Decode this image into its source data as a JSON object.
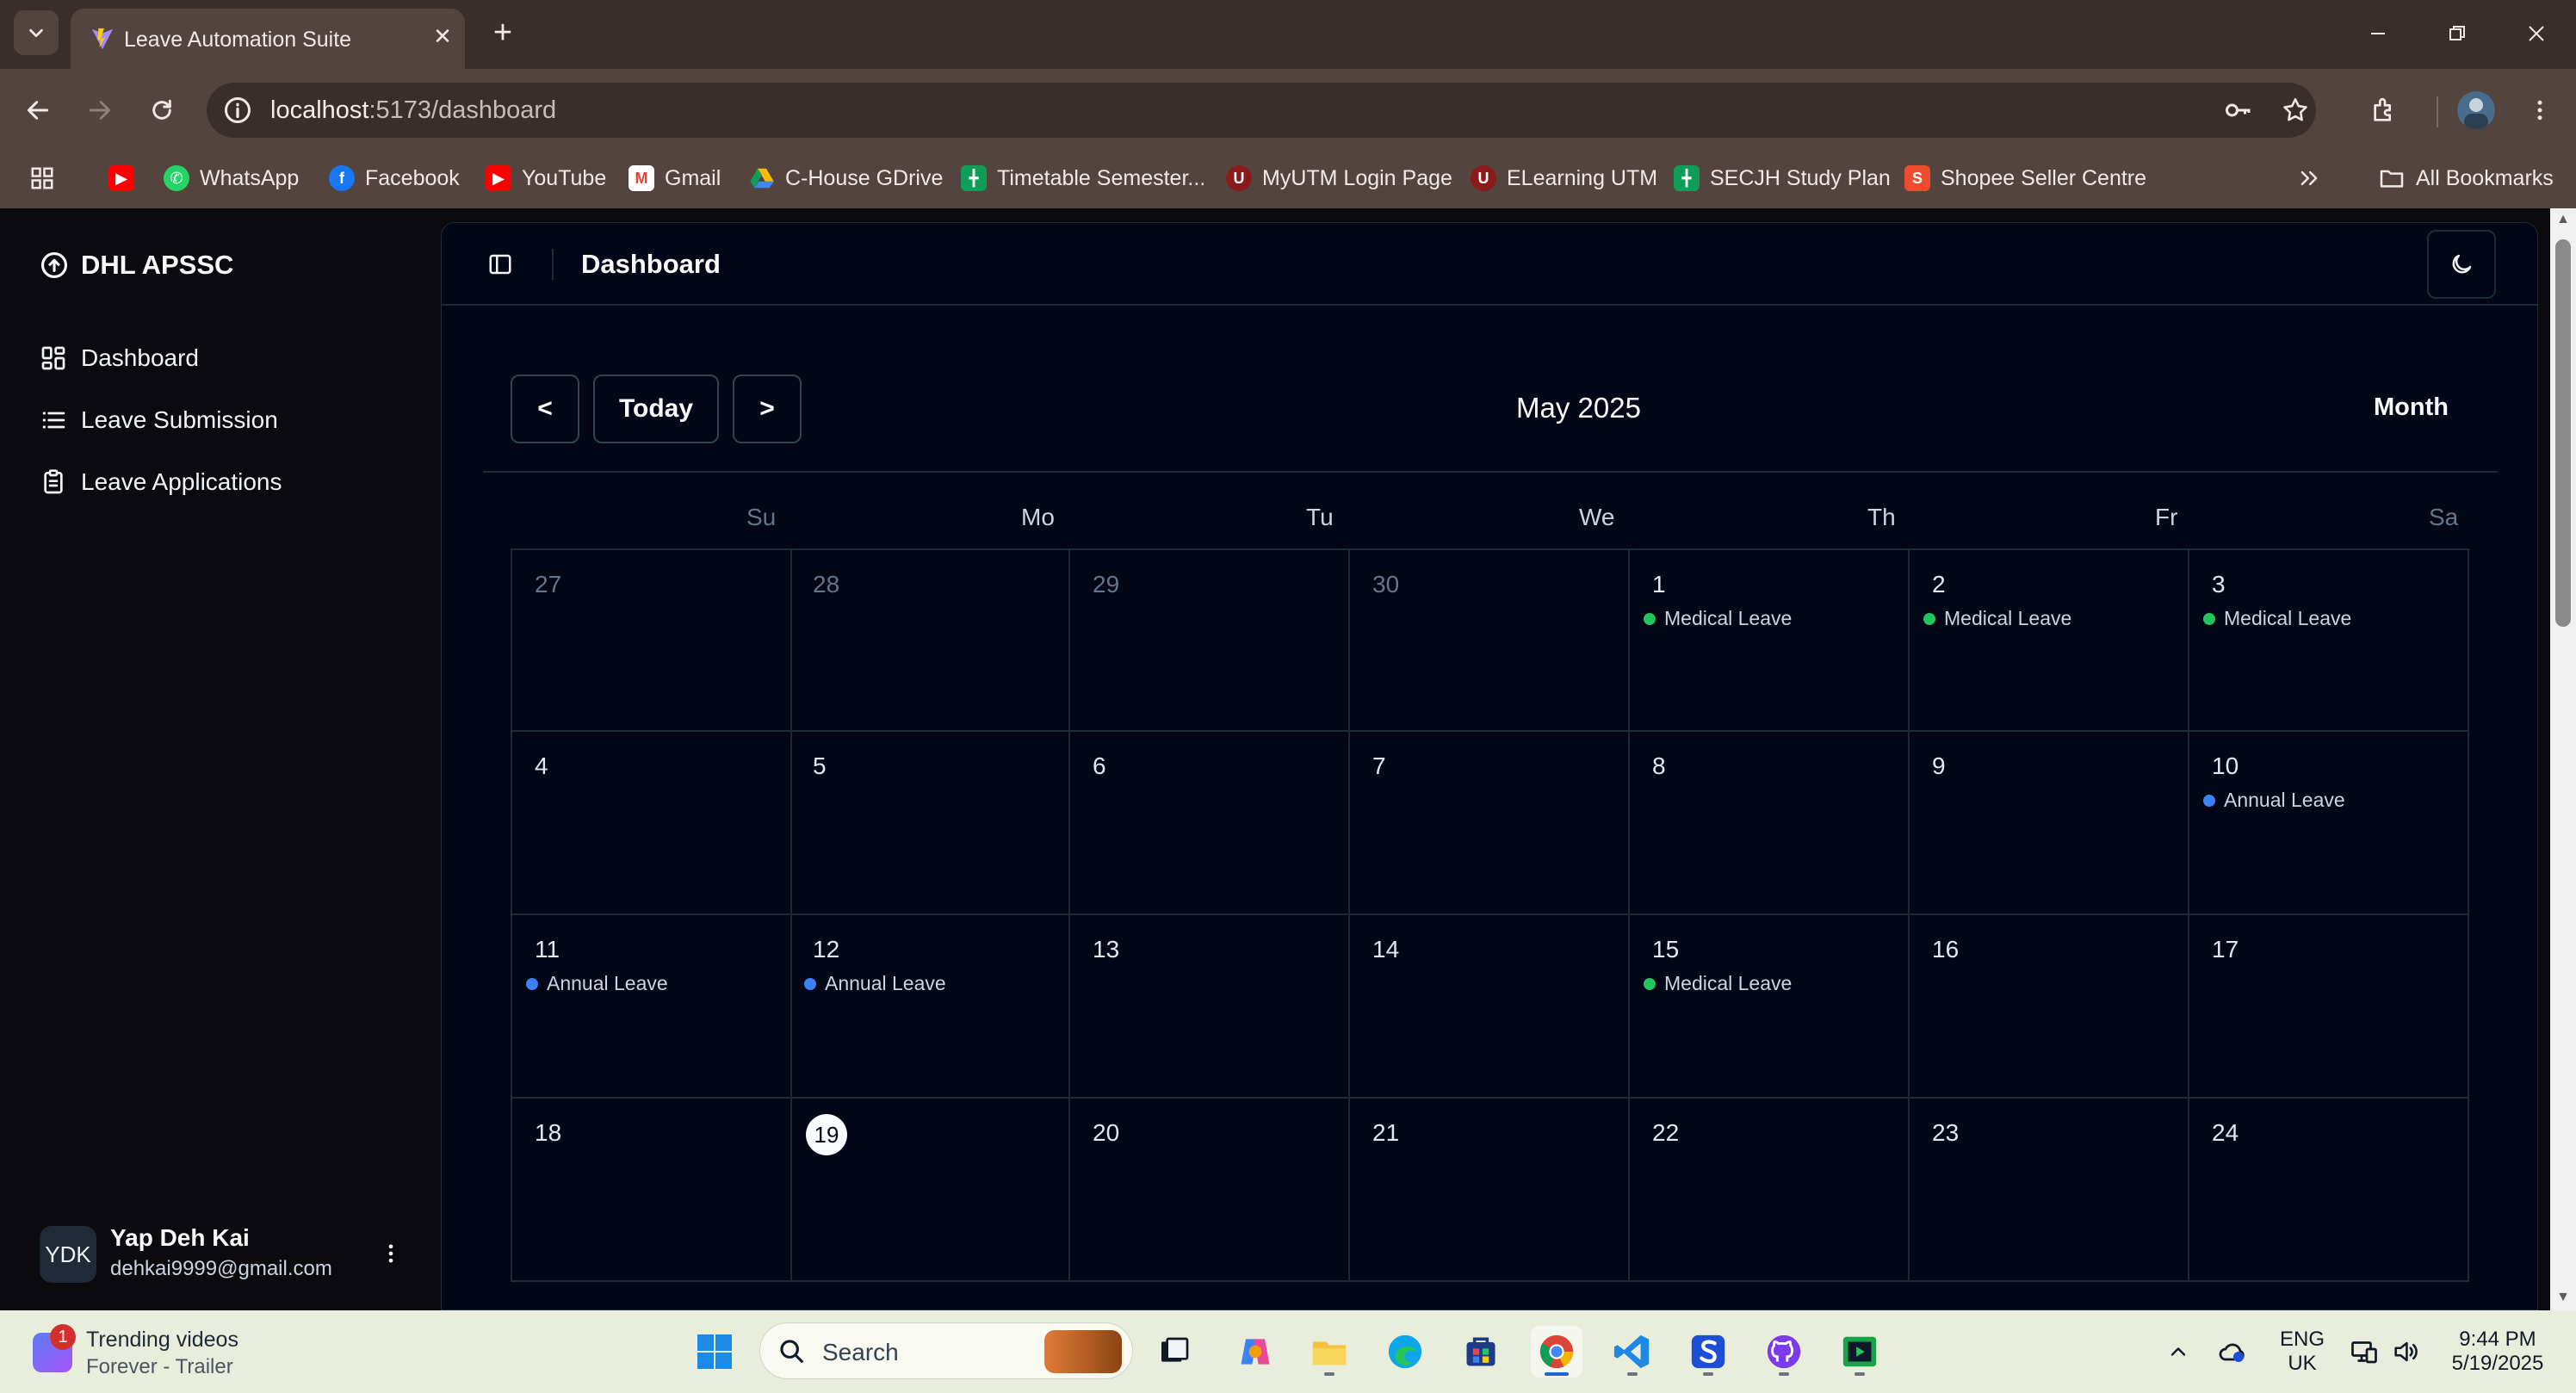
{
  "browser": {
    "tab_title": "Leave Automation Suite",
    "url_host": "localhost",
    "url_path": ":5173/dashboard",
    "bookmarks": [
      {
        "label": "",
        "icon": "youtube-icon",
        "color": "#ff0000"
      },
      {
        "label": "WhatsApp",
        "icon": "whatsapp-icon",
        "color": "#25d366"
      },
      {
        "label": "Facebook",
        "icon": "facebook-icon",
        "color": "#1877f2"
      },
      {
        "label": "YouTube",
        "icon": "youtube-icon",
        "color": "#ff0000"
      },
      {
        "label": "Gmail",
        "icon": "gmail-icon",
        "color": "#ea4335"
      },
      {
        "label": "C-House GDrive",
        "icon": "gdrive-icon",
        "color": "#fbbc04"
      },
      {
        "label": "Timetable Semester...",
        "icon": "sheets-icon",
        "color": "#0f9d58"
      },
      {
        "label": "MyUTM Login Page",
        "icon": "utm-icon",
        "color": "#8b1a1a"
      },
      {
        "label": "ELearning UTM",
        "icon": "utm-icon",
        "color": "#8b1a1a"
      },
      {
        "label": "SECJH Study Plan",
        "icon": "sheets-icon",
        "color": "#0f9d58"
      },
      {
        "label": "Shopee Seller Centre",
        "icon": "shopee-icon",
        "color": "#ee4d2d"
      }
    ],
    "all_bookmarks": "All Bookmarks"
  },
  "app": {
    "brand": "DHL APSSC",
    "nav": [
      {
        "label": "Dashboard",
        "icon": "grid-icon"
      },
      {
        "label": "Leave Submission",
        "icon": "list-icon"
      },
      {
        "label": "Leave Applications",
        "icon": "clipboard-icon"
      }
    ],
    "user": {
      "initials": "YDK",
      "name": "Yap Deh Kai",
      "email": "dehkai9999@gmail.com"
    },
    "page_title": "Dashboard"
  },
  "calendar": {
    "prev_label": "<",
    "today_label": "Today",
    "next_label": ">",
    "title": "May 2025",
    "view": "Month",
    "weekdays": [
      "Su",
      "Mo",
      "Tu",
      "We",
      "Th",
      "Fr",
      "Sa"
    ],
    "weeks": [
      [
        {
          "day": "27",
          "outside": true,
          "events": []
        },
        {
          "day": "28",
          "outside": true,
          "events": []
        },
        {
          "day": "29",
          "outside": true,
          "events": []
        },
        {
          "day": "30",
          "outside": true,
          "events": []
        },
        {
          "day": "1",
          "events": [
            {
              "label": "Medical Leave",
              "type": "medical"
            }
          ]
        },
        {
          "day": "2",
          "events": [
            {
              "label": "Medical Leave",
              "type": "medical"
            }
          ]
        },
        {
          "day": "3",
          "events": [
            {
              "label": "Medical Leave",
              "type": "medical"
            }
          ]
        }
      ],
      [
        {
          "day": "4",
          "events": []
        },
        {
          "day": "5",
          "events": []
        },
        {
          "day": "6",
          "events": []
        },
        {
          "day": "7",
          "events": []
        },
        {
          "day": "8",
          "events": []
        },
        {
          "day": "9",
          "events": []
        },
        {
          "day": "10",
          "events": [
            {
              "label": "Annual Leave",
              "type": "annual"
            }
          ]
        }
      ],
      [
        {
          "day": "11",
          "events": [
            {
              "label": "Annual Leave",
              "type": "annual"
            }
          ]
        },
        {
          "day": "12",
          "events": [
            {
              "label": "Annual Leave",
              "type": "annual"
            }
          ]
        },
        {
          "day": "13",
          "events": []
        },
        {
          "day": "14",
          "events": []
        },
        {
          "day": "15",
          "events": [
            {
              "label": "Medical Leave",
              "type": "medical"
            }
          ]
        },
        {
          "day": "16",
          "events": []
        },
        {
          "day": "17",
          "events": []
        }
      ],
      [
        {
          "day": "18",
          "events": []
        },
        {
          "day": "19",
          "today": true,
          "events": []
        },
        {
          "day": "20",
          "events": []
        },
        {
          "day": "21",
          "events": []
        },
        {
          "day": "22",
          "events": []
        },
        {
          "day": "23",
          "events": []
        },
        {
          "day": "24",
          "events": []
        }
      ]
    ],
    "colors": {
      "medical": "#22c55e",
      "annual": "#3b82f6"
    }
  },
  "taskbar": {
    "widget_title": "Trending videos",
    "widget_subtitle": "Forever - Trailer",
    "widget_badge": "1",
    "search_label": "Search",
    "language": "ENG",
    "region": "UK",
    "time": "9:44 PM",
    "date": "5/19/2025"
  }
}
